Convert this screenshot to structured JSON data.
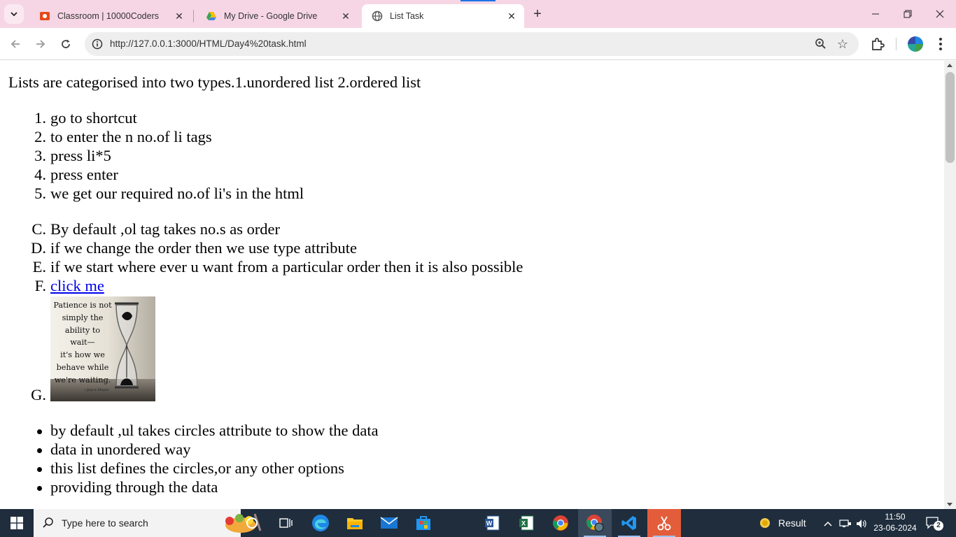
{
  "browser": {
    "tabs": [
      {
        "title": "Classroom | 10000Coders",
        "icon": "classroom-favicon"
      },
      {
        "title": "My Drive - Google Drive",
        "icon": "google-drive-icon"
      },
      {
        "title": "List Task",
        "icon": "globe-icon",
        "active": true
      }
    ],
    "url": "http://127.0.0.1:3000/HTML/Day4%20task.html"
  },
  "page": {
    "intro": "Lists are categorised into two types.1.unordered list 2.ordered list",
    "list1": {
      "markers": [
        "1.",
        "2.",
        "3.",
        "4.",
        "5."
      ],
      "items": [
        "go to shortcut",
        "to enter the n no.of li tags",
        "press li*5",
        "press enter",
        "we get our required no.of li's in the html"
      ]
    },
    "list2": {
      "markers": [
        "C.",
        "D.",
        "E.",
        "F.",
        "G."
      ],
      "items": [
        "By default ,ol tag takes no.s as order",
        "if we change the order then we use type attribute",
        "if we start where ever u want from a particular order then it is also possible"
      ],
      "link": "click me",
      "image_quote": [
        "Patience is not",
        "simply the",
        "ability to",
        "wait—",
        "it's how we",
        "behave while",
        "we're waiting."
      ],
      "image_author": "~Joyce Meyer"
    },
    "list3": {
      "items": [
        "by default ,ul takes circles attribute to show the data",
        "data in unordered way",
        "this list defines the circles,or any other options",
        "providing through the data"
      ]
    }
  },
  "taskbar": {
    "search_placeholder": "Type here to search",
    "weather_label": "Result",
    "time": "11:50",
    "date": "23-06-2024",
    "notifications": "2"
  }
}
